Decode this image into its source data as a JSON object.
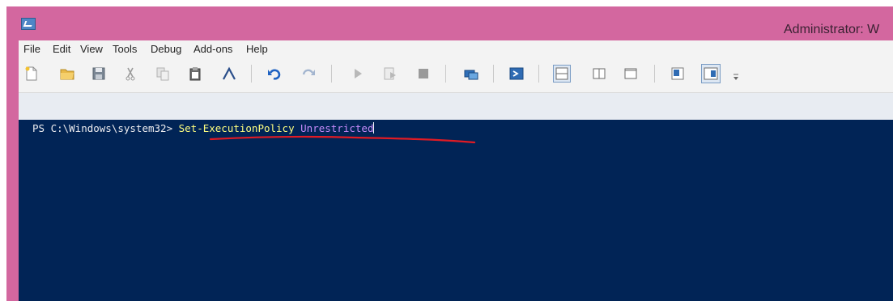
{
  "window": {
    "title": "Administrator: W",
    "frame_color": "#d3679f"
  },
  "menu": {
    "items": [
      "File",
      "Edit",
      "View",
      "Tools",
      "Debug",
      "Add-ons",
      "Help"
    ]
  },
  "toolbar": {
    "icons": [
      "new-icon",
      "open-icon",
      "save-icon",
      "cut-icon",
      "copy-icon",
      "paste-icon",
      "clear-icon",
      "undo-icon",
      "redo-icon",
      "run-icon",
      "run-selection-icon",
      "stop-icon",
      "remote-icon",
      "powershell-icon",
      "layout-top-icon",
      "layout-right-icon",
      "layout-max-icon",
      "show-commands-icon",
      "show-addon-icon",
      "toolbar-overflow-icon"
    ]
  },
  "console": {
    "prompt": "PS C:\\Windows\\system32> ",
    "command": "Set-ExecutionPolicy",
    "argument": "Unrestricted",
    "background": "#012456",
    "command_color": "#ffff80",
    "argument_color": "#c58af9",
    "annotation_color": "#e01b24"
  }
}
